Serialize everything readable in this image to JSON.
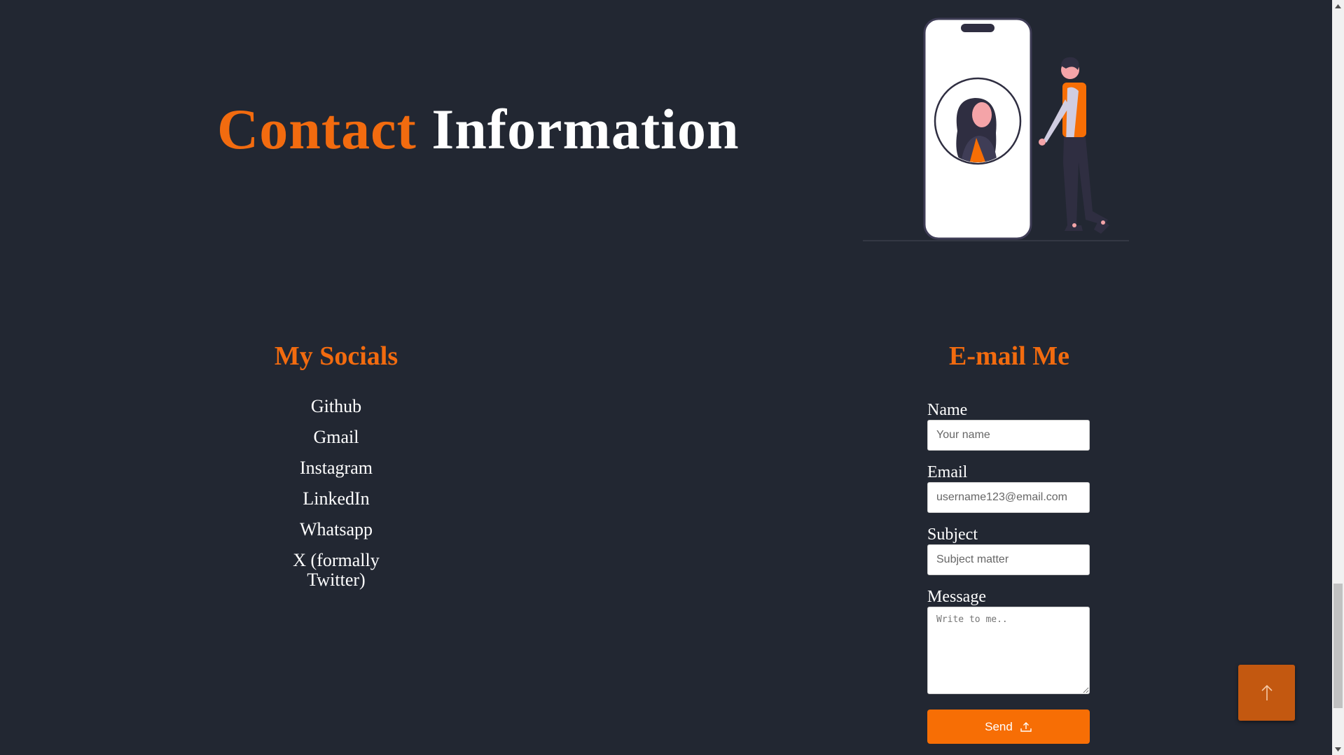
{
  "header": {
    "title_accent": "Contact",
    "title_rest": "Information"
  },
  "socials": {
    "heading": "My Socials",
    "items": [
      "Github",
      "Gmail",
      "Instagram",
      "LinkedIn",
      "Whatsapp",
      "X (formally Twitter)"
    ]
  },
  "email_form": {
    "heading": "E-mail Me",
    "name_label": "Name",
    "name_placeholder": "Your name",
    "email_label": "Email",
    "email_placeholder": "username123@email.com",
    "subject_label": "Subject",
    "subject_placeholder": "Subject matter",
    "message_label": "Message",
    "message_placeholder": "Write to me..",
    "send_label": "Send",
    "send_icon": "upload-icon"
  },
  "back_to_top": {
    "icon": "arrow-up-icon"
  },
  "colors": {
    "background": "#222732",
    "accent": "#f26b0f",
    "send_button": "#f76e05",
    "back_to_top": "#c35810",
    "text": "#ffffff"
  }
}
